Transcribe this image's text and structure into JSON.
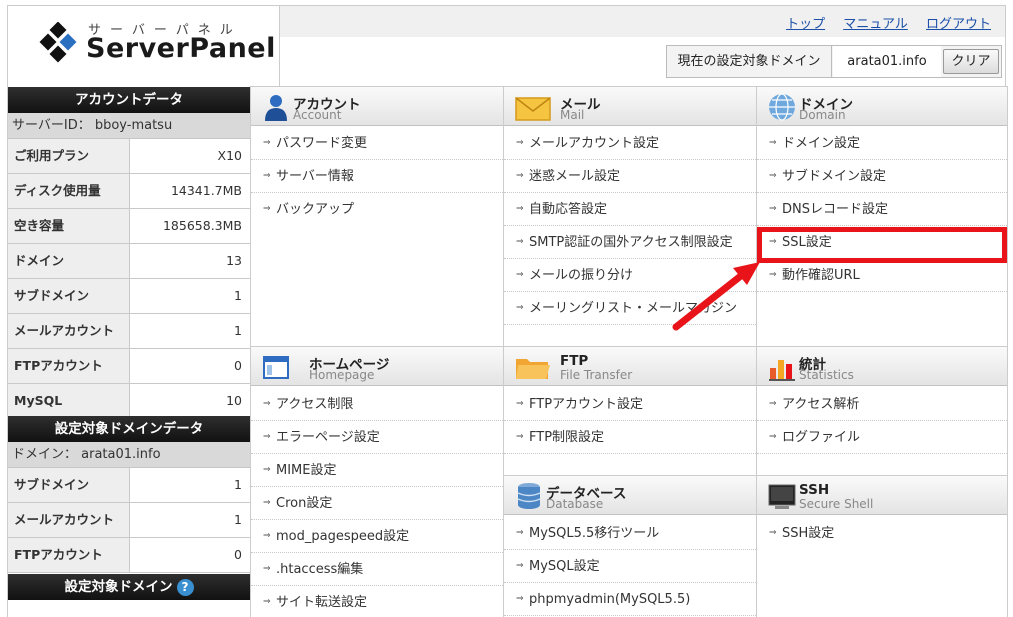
{
  "header": {
    "logo_sub": "サーバーパネル",
    "logo_text": "ServerPanel",
    "links": [
      "トップ",
      "マニュアル",
      "ログアウト"
    ],
    "domain_label": "現在の設定対象ドメイン",
    "domain_value": "arata01.info",
    "clear_label": "クリア"
  },
  "sidebar": {
    "account_head": "アカウントデータ",
    "server_id": "サーバーID： bboy-matsu",
    "account_rows": [
      {
        "k": "ご利用プラン",
        "v": "X10"
      },
      {
        "k": "ディスク使用量",
        "v": "14341.7MB"
      },
      {
        "k": "空き容量",
        "v": "185658.3MB"
      },
      {
        "k": "ドメイン",
        "v": "13"
      },
      {
        "k": "サブドメイン",
        "v": "1"
      },
      {
        "k": "メールアカウント",
        "v": "1"
      },
      {
        "k": "FTPアカウント",
        "v": "0"
      },
      {
        "k": "MySQL",
        "v": "10"
      }
    ],
    "domain_head": "設定対象ドメインデータ",
    "domain_line": "ドメイン： arata01.info",
    "domain_rows": [
      {
        "k": "サブドメイン",
        "v": "1"
      },
      {
        "k": "メールアカウント",
        "v": "1"
      },
      {
        "k": "FTPアカウント",
        "v": "0"
      }
    ],
    "target_head": "設定対象ドメイン",
    "help": "?"
  },
  "sections": {
    "account": {
      "title": "アカウント",
      "en": "Account",
      "items": [
        "パスワード変更",
        "サーバー情報",
        "バックアップ"
      ]
    },
    "mail": {
      "title": "メール",
      "en": "Mail",
      "items": [
        "メールアカウント設定",
        "迷惑メール設定",
        "自動応答設定",
        "SMTP認証の国外アクセス制限設定",
        "メールの振り分け",
        "メーリングリスト・メールマガジン"
      ]
    },
    "domain": {
      "title": "ドメイン",
      "en": "Domain",
      "items": [
        "ドメイン設定",
        "サブドメイン設定",
        "DNSレコード設定",
        "SSL設定",
        "動作確認URL"
      ]
    },
    "homepage": {
      "title": "ホームページ",
      "en": "Homepage",
      "items": [
        "アクセス制限",
        "エラーページ設定",
        "MIME設定",
        "Cron設定",
        "mod_pagespeed設定",
        ".htaccess編集",
        "サイト転送設定"
      ]
    },
    "ftp": {
      "title": "FTP",
      "en": "File Transfer",
      "items": [
        "FTPアカウント設定",
        "FTP制限設定"
      ]
    },
    "stats": {
      "title": "統計",
      "en": "Statistics",
      "items": [
        "アクセス解析",
        "ログファイル"
      ]
    },
    "database": {
      "title": "データベース",
      "en": "Database",
      "items": [
        "MySQL5.5移行ツール",
        "MySQL設定",
        "phpmyadmin(MySQL5.5)"
      ]
    },
    "ssh": {
      "title": "SSH",
      "en": "Secure Shell",
      "items": [
        "SSH設定"
      ]
    }
  },
  "colors": {
    "highlight": "#e8141a",
    "link": "#1a4fa8"
  }
}
